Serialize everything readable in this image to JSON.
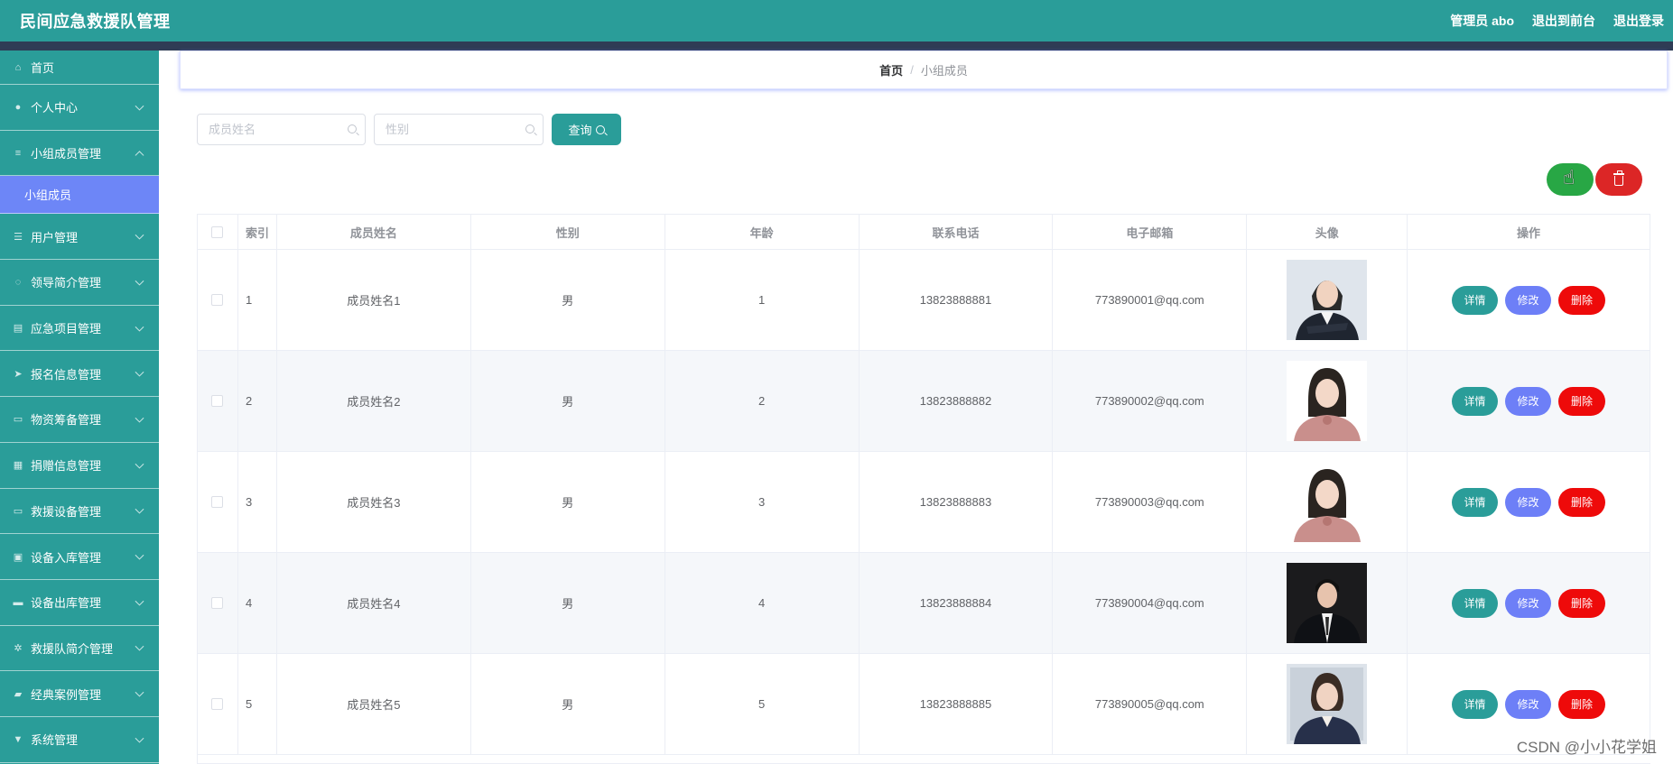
{
  "header": {
    "title": "民间应急救援队管理",
    "admin": "管理员 abo",
    "back_to_front": "退出到前台",
    "logout": "退出登录"
  },
  "sidebar": {
    "items": [
      {
        "label": "首页",
        "icon": "home-icon"
      },
      {
        "label": "个人中心",
        "icon": "user-icon"
      },
      {
        "label": "小组成员管理",
        "icon": "list-icon",
        "expanded": true,
        "children": [
          {
            "label": "小组成员",
            "active": true
          }
        ]
      },
      {
        "label": "用户管理",
        "icon": "sliders-icon"
      },
      {
        "label": "领导简介管理",
        "icon": "clock-icon"
      },
      {
        "label": "应急项目管理",
        "icon": "clipboard-icon"
      },
      {
        "label": "报名信息管理",
        "icon": "send-icon"
      },
      {
        "label": "物资筹备管理",
        "icon": "monitor-icon"
      },
      {
        "label": "捐赠信息管理",
        "icon": "grid-icon"
      },
      {
        "label": "救援设备管理",
        "icon": "chat-icon"
      },
      {
        "label": "设备入库管理",
        "icon": "briefcase-icon"
      },
      {
        "label": "设备出库管理",
        "icon": "message-icon"
      },
      {
        "label": "救援队简介管理",
        "icon": "settings-icon"
      },
      {
        "label": "经典案例管理",
        "icon": "ticket-icon"
      },
      {
        "label": "系统管理",
        "icon": "trophy-icon"
      }
    ]
  },
  "breadcrumb": {
    "home": "首页",
    "separator": "/",
    "current": "小组成员"
  },
  "search": {
    "name_placeholder": "成员姓名",
    "gender_placeholder": "性别",
    "query_label": "查询"
  },
  "table": {
    "headers": {
      "index": "索引",
      "name": "成员姓名",
      "gender": "性别",
      "age": "年龄",
      "phone": "联系电话",
      "email": "电子邮箱",
      "avatar": "头像",
      "actions": "操作"
    },
    "rows": [
      {
        "index": "1",
        "name": "成员姓名1",
        "gender": "男",
        "age": "1",
        "phone": "13823888881",
        "email": "773890001@qq.com"
      },
      {
        "index": "2",
        "name": "成员姓名2",
        "gender": "男",
        "age": "2",
        "phone": "13823888882",
        "email": "773890002@qq.com"
      },
      {
        "index": "3",
        "name": "成员姓名3",
        "gender": "男",
        "age": "3",
        "phone": "13823888883",
        "email": "773890003@qq.com"
      },
      {
        "index": "4",
        "name": "成员姓名4",
        "gender": "男",
        "age": "4",
        "phone": "13823888884",
        "email": "773890004@qq.com"
      },
      {
        "index": "5",
        "name": "成员姓名5",
        "gender": "男",
        "age": "5",
        "phone": "13823888885",
        "email": "773890005@qq.com"
      }
    ],
    "actions": {
      "detail": "详情",
      "edit": "修改",
      "delete": "删除"
    }
  },
  "colors": {
    "primary": "#2a9d99",
    "submenu_active": "#6d86f7",
    "add": "#28a745",
    "delete": "#ee0a0a",
    "edit": "#6d7ff7"
  },
  "watermark": "CSDN @小小花学姐"
}
